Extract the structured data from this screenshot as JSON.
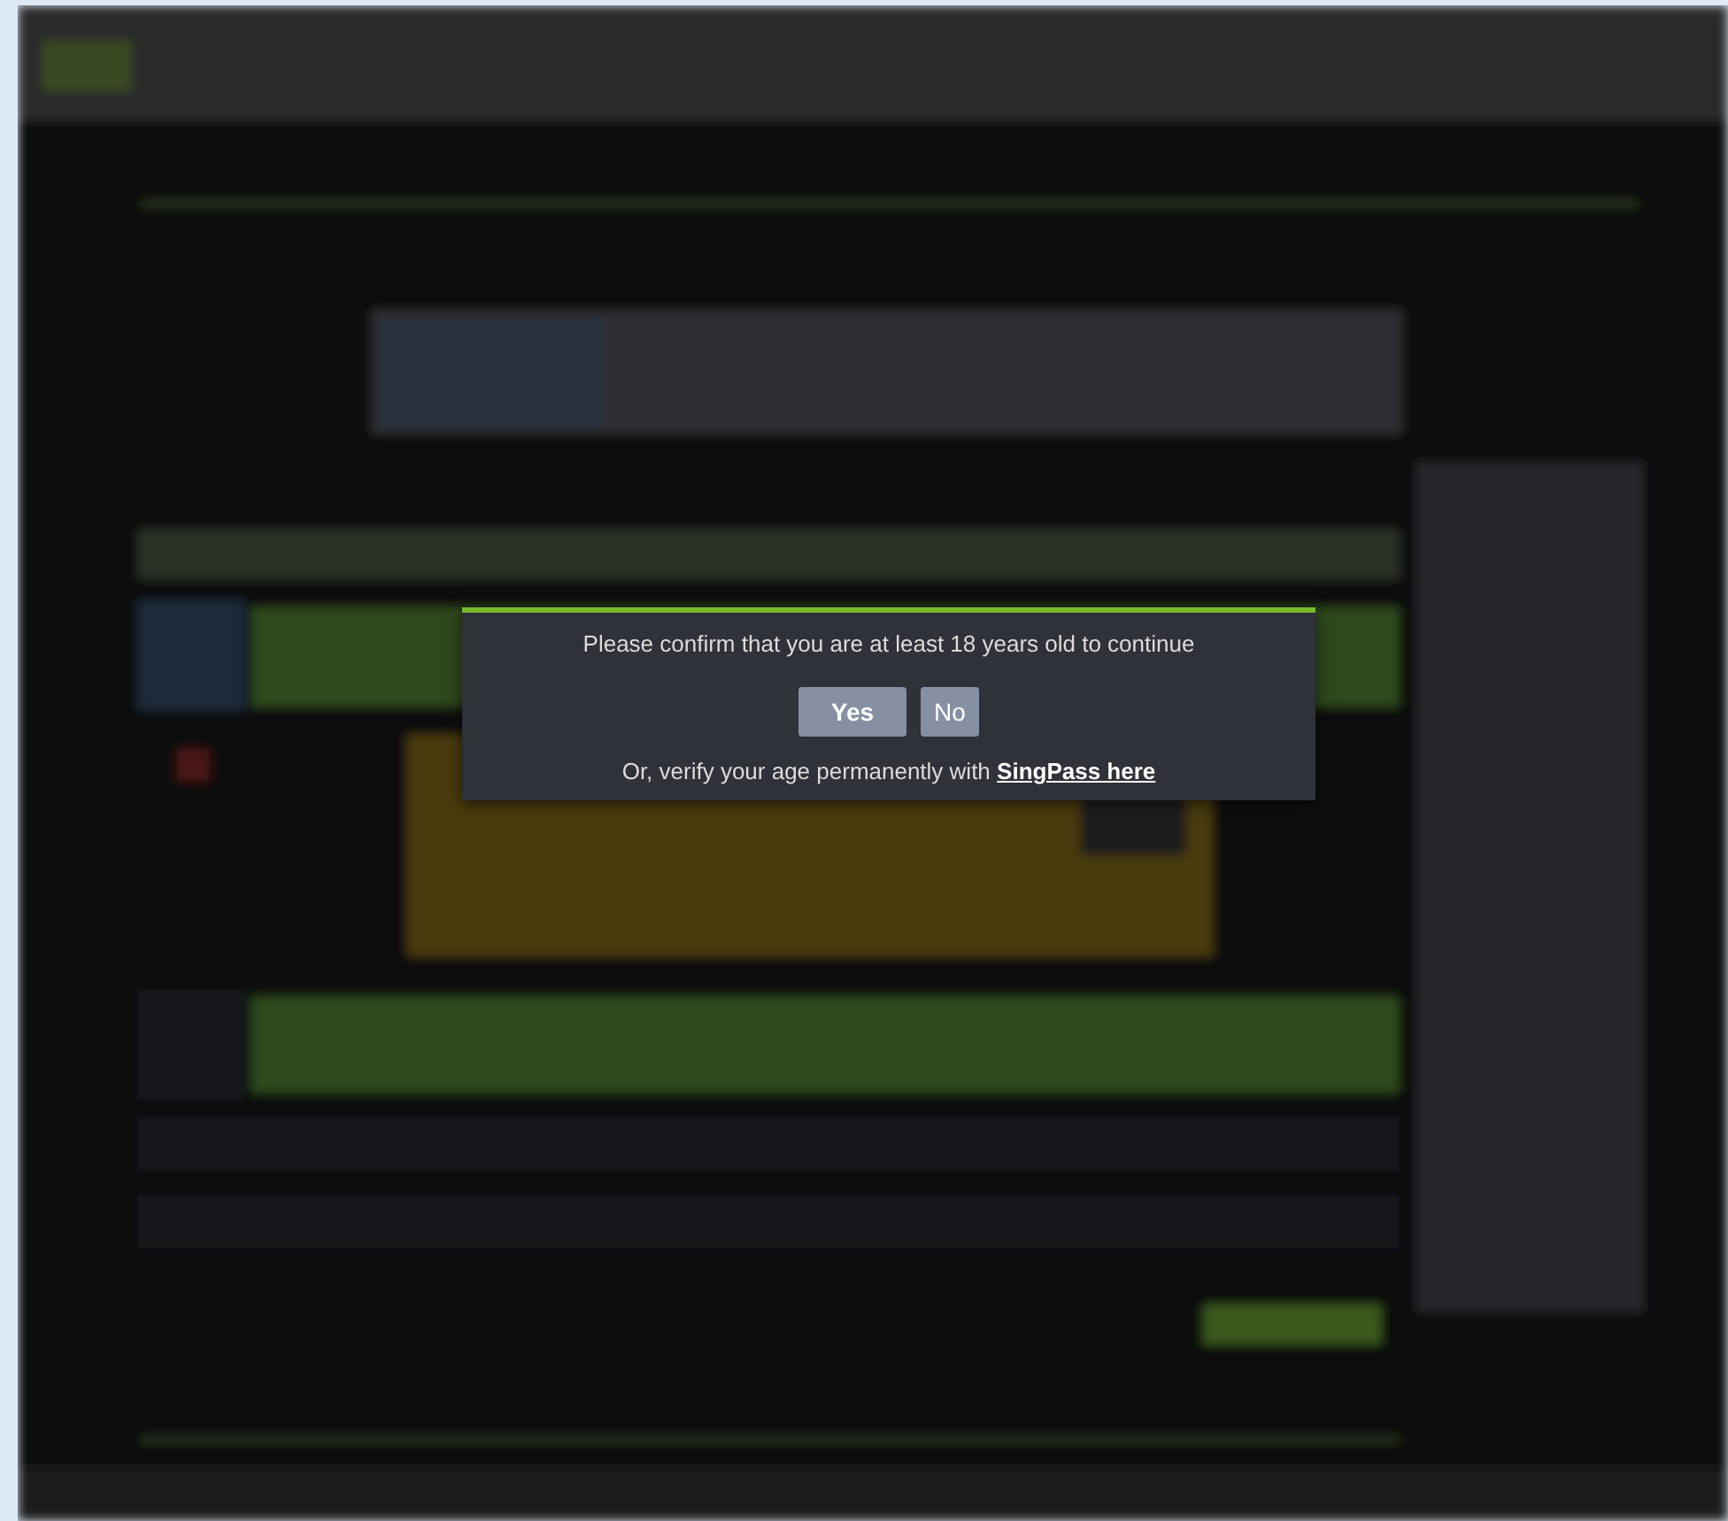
{
  "dialog": {
    "message": "Please confirm that you are at least 18 years old to continue",
    "buttons": [
      {
        "label": "Yes",
        "kind": "primary"
      },
      {
        "label": "No",
        "kind": "secondary"
      }
    ],
    "footer": {
      "text": "Or, verify your age permanently with",
      "link": "SingPass here"
    }
  }
}
